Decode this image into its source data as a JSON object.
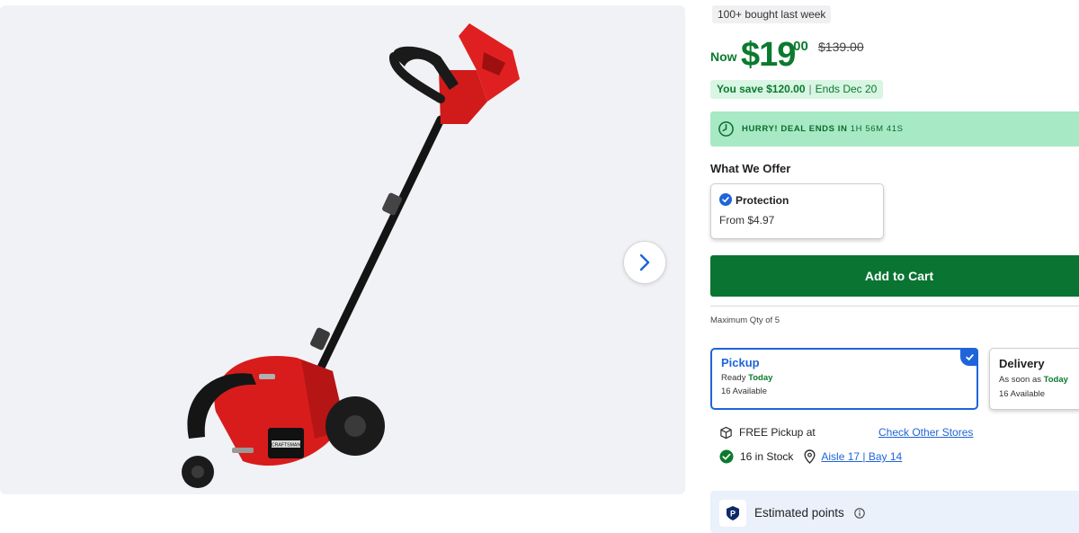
{
  "gallery": {
    "image_alt": "Craftsman edger",
    "brand_plate": "CRAFTSMAN",
    "next_icon": "chevron-right-icon"
  },
  "badge": {
    "text": "100+ bought last week"
  },
  "price": {
    "now_label": "Now",
    "dollars": "$19",
    "cents": ".00",
    "was": "$139.00"
  },
  "savings": {
    "amount": "You save $120.00",
    "separator": "|",
    "ends": "Ends Dec 20"
  },
  "deal": {
    "icon": "clock-icon",
    "label": "HURRY! DEAL ENDS IN",
    "timer": "1H 56M 41S"
  },
  "offer": {
    "title": "What We Offer",
    "protection_title": "Protection",
    "protection_price": "From $4.97"
  },
  "cart": {
    "button_label": "Add to Cart",
    "max_qty": "Maximum Qty of 5"
  },
  "fulfillment": {
    "pickup": {
      "title": "Pickup",
      "ready_prefix": "Ready",
      "ready_day": "Today",
      "available": "16 Available"
    },
    "delivery": {
      "title": "Delivery",
      "prefix": "As soon as",
      "day": "Today",
      "available": "16 Available"
    }
  },
  "store": {
    "pickup_text": "FREE Pickup at",
    "check_link": "Check Other Stores",
    "stock_text": "16 in Stock",
    "aisle_link": "Aisle 17 | Bay 14"
  },
  "points": {
    "badge_letter": "P",
    "label": "Estimated points"
  },
  "colors": {
    "brand_green": "#0a7432",
    "price_green": "#0b7a2f",
    "deal_banner": "#a6e9c4",
    "select_blue": "#1f64d9"
  }
}
